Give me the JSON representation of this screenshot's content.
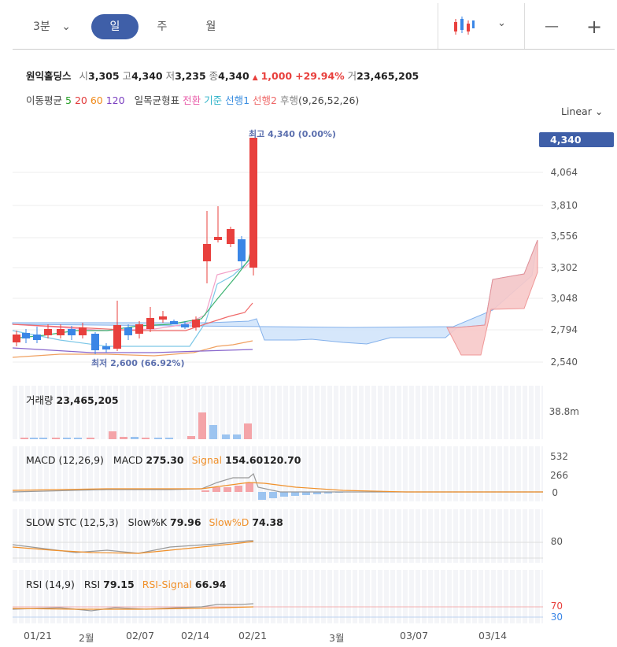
{
  "toolbar": {
    "interval": "3분",
    "periods": [
      "일",
      "주",
      "월"
    ],
    "active_period": "일",
    "zoom_out": "—",
    "zoom_in": "+"
  },
  "quote": {
    "name": "원익홀딩스",
    "open_label": "시",
    "open": "3,305",
    "high_label": "고",
    "high": "4,340",
    "low_label": "저",
    "low": "3,235",
    "close_label": "종",
    "close": "4,340",
    "change": "1,000",
    "change_pct": "+29.94%",
    "volume_label": "거",
    "volume": "23,465,205"
  },
  "indicators": {
    "ma_label": "이동평균",
    "ma": [
      {
        "period": "5",
        "color": "#2aa02a"
      },
      {
        "period": "20",
        "color": "#e23a3a"
      },
      {
        "period": "60",
        "color": "#f08a1a"
      },
      {
        "period": "120",
        "color": "#7b3fc0"
      }
    ],
    "ichimoku_label": "일목균형표",
    "ichimoku": [
      {
        "name": "전환",
        "color": "#e85ca8"
      },
      {
        "name": "기준",
        "color": "#2fb3c9"
      },
      {
        "name": "선행1",
        "color": "#3a8ee0"
      },
      {
        "name": "선행2",
        "color": "#e66"
      },
      {
        "name": "후행",
        "color": "#888"
      }
    ],
    "ichimoku_params": "(9,26,52,26)"
  },
  "scale": {
    "label": "Linear"
  },
  "price_axis": {
    "current": "4,340",
    "ticks": [
      "4,064",
      "3,810",
      "3,556",
      "3,302",
      "3,048",
      "2,794",
      "2,540"
    ]
  },
  "annotations": {
    "max": "최고 4,340 (0.00%)",
    "min": "최저 2,600 (66.92%)"
  },
  "volume_panel": {
    "label": "거래량",
    "value": "23,465,205",
    "axis": "38.8m"
  },
  "macd_panel": {
    "label": "MACD (12,26,9)",
    "macd_label": "MACD",
    "macd_value": "275.30",
    "signal_label": "Signal",
    "signal_value": "154.60",
    "hist_value": "120.70",
    "axis": [
      "532",
      "266",
      "0"
    ]
  },
  "stc_panel": {
    "label": "SLOW STC (12,5,3)",
    "k_label": "Slow%K",
    "k_value": "79.96",
    "d_label": "Slow%D",
    "d_value": "74.38",
    "axis": "80"
  },
  "rsi_panel": {
    "label": "RSI (14,9)",
    "rsi_label": "RSI",
    "rsi_value": "79.15",
    "signal_label": "RSI-Signal",
    "signal_value": "66.94",
    "axis_70": "70",
    "axis_30": "30"
  },
  "x_axis": [
    "01/21",
    "2월",
    "02/07",
    "02/14",
    "02/21",
    "3월",
    "03/07",
    "03/14"
  ],
  "colors": {
    "up": "#e8403d",
    "down": "#3a86e6",
    "brand": "#3f5fa8"
  }
}
